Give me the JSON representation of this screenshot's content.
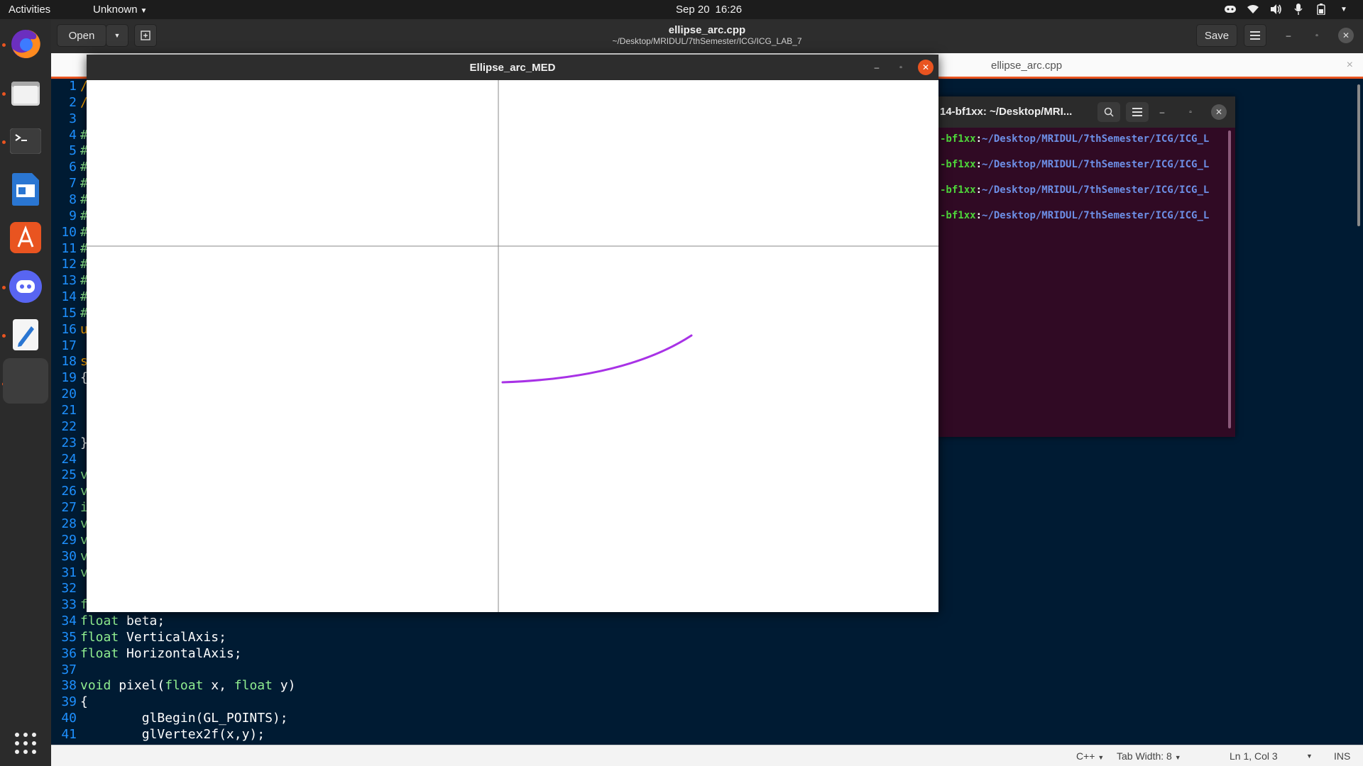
{
  "topbar": {
    "activities": "Activities",
    "app_menu": "Unknown",
    "date": "Sep 20",
    "time": "16:26",
    "tray_icons": [
      "discord-icon",
      "wifi-icon",
      "volume-icon",
      "microphone-icon",
      "battery-icon",
      "chevron-down-icon"
    ]
  },
  "dock": {
    "items": [
      "firefox-icon",
      "files-icon",
      "terminal-icon",
      "writer-icon",
      "app-center-icon",
      "discord-icon",
      "text-editor-icon",
      "active-window-icon"
    ],
    "show_apps_icon": "grid-icon"
  },
  "editor": {
    "open_label": "Open",
    "title": "ellipse_arc.cpp",
    "path": "~/Desktop/MRIDUL/7thSemester/ICG/ICG_LAB_7",
    "save_label": "Save",
    "tab_label": "ellipse_arc.cpp",
    "tab_close": "×",
    "lines": [
      {
        "n": "1",
        "parts": [
          [
            "kw2",
            "/"
          ]
        ]
      },
      {
        "n": "2",
        "parts": [
          [
            "kw2",
            "/"
          ]
        ]
      },
      {
        "n": "3",
        "parts": []
      },
      {
        "n": "4",
        "parts": [
          [
            "kw",
            "#"
          ]
        ]
      },
      {
        "n": "5",
        "parts": [
          [
            "kw",
            "#"
          ]
        ]
      },
      {
        "n": "6",
        "parts": [
          [
            "kw",
            "#"
          ]
        ]
      },
      {
        "n": "7",
        "parts": [
          [
            "kw",
            "#"
          ]
        ]
      },
      {
        "n": "8",
        "parts": [
          [
            "kw",
            "#"
          ]
        ]
      },
      {
        "n": "9",
        "parts": [
          [
            "kw",
            "#"
          ]
        ]
      },
      {
        "n": "10",
        "parts": [
          [
            "kw",
            "#"
          ]
        ]
      },
      {
        "n": "11",
        "parts": [
          [
            "kw",
            "#"
          ]
        ]
      },
      {
        "n": "12",
        "parts": [
          [
            "kw",
            "#"
          ]
        ]
      },
      {
        "n": "13",
        "parts": [
          [
            "kw",
            "#"
          ]
        ]
      },
      {
        "n": "14",
        "parts": [
          [
            "kw",
            "#"
          ]
        ]
      },
      {
        "n": "15",
        "parts": [
          [
            "kw",
            "#"
          ]
        ]
      },
      {
        "n": "16",
        "parts": [
          [
            "kw2",
            "u"
          ]
        ]
      },
      {
        "n": "17",
        "parts": []
      },
      {
        "n": "18",
        "parts": [
          [
            "kw2",
            "s"
          ]
        ]
      },
      {
        "n": "19",
        "parts": [
          [
            "txt",
            "{"
          ]
        ]
      },
      {
        "n": "20",
        "parts": []
      },
      {
        "n": "21",
        "parts": []
      },
      {
        "n": "22",
        "parts": []
      },
      {
        "n": "23",
        "parts": [
          [
            "txt",
            "}"
          ]
        ]
      },
      {
        "n": "24",
        "parts": []
      },
      {
        "n": "25",
        "parts": [
          [
            "kw",
            "v"
          ]
        ]
      },
      {
        "n": "26",
        "parts": [
          [
            "kw",
            "v"
          ]
        ]
      },
      {
        "n": "27",
        "parts": [
          [
            "kw",
            "i"
          ]
        ]
      },
      {
        "n": "28",
        "parts": [
          [
            "kw",
            "v"
          ]
        ]
      },
      {
        "n": "29",
        "parts": [
          [
            "kw",
            "v"
          ]
        ]
      },
      {
        "n": "30",
        "parts": [
          [
            "kw",
            "v"
          ]
        ]
      },
      {
        "n": "31",
        "parts": [
          [
            "kw",
            "v"
          ]
        ]
      },
      {
        "n": "32",
        "parts": []
      },
      {
        "n": "33",
        "parts": [
          [
            "kw",
            "f"
          ]
        ]
      },
      {
        "n": "34",
        "parts": [
          [
            "kw",
            "float"
          ],
          [
            "txt",
            " beta;"
          ]
        ]
      },
      {
        "n": "35",
        "parts": [
          [
            "kw",
            "float"
          ],
          [
            "txt",
            " VerticalAxis;"
          ]
        ]
      },
      {
        "n": "36",
        "parts": [
          [
            "kw",
            "float"
          ],
          [
            "txt",
            " HorizontalAxis;"
          ]
        ]
      },
      {
        "n": "37",
        "parts": []
      },
      {
        "n": "38",
        "parts": [
          [
            "kw",
            "void"
          ],
          [
            "txt",
            " pixel("
          ],
          [
            "kw",
            "float"
          ],
          [
            "txt",
            " x, "
          ],
          [
            "kw",
            "float"
          ],
          [
            "txt",
            " y)"
          ]
        ]
      },
      {
        "n": "39",
        "parts": [
          [
            "txt",
            "{"
          ]
        ]
      },
      {
        "n": "40",
        "parts": [
          [
            "txt",
            "        glBegin(GL_POINTS);"
          ]
        ]
      },
      {
        "n": "41",
        "parts": [
          [
            "txt",
            "        glVertex2f(x,y);"
          ]
        ]
      }
    ],
    "status": {
      "language": "C++",
      "tab_width": "Tab Width: 8",
      "position": "Ln 1, Col 3",
      "mode": "INS"
    }
  },
  "terminal": {
    "title": "14-bf1xx: ~/Desktop/MRI...",
    "lines": [
      {
        "user": "-bf1xx",
        "sep": ":",
        "path": "~/Desktop/MRIDUL/7thSemester/ICG/ICG_L"
      },
      {
        "user": "-bf1xx",
        "sep": ":",
        "path": "~/Desktop/MRIDUL/7thSemester/ICG/ICG_L"
      },
      {
        "user": "-bf1xx",
        "sep": ":",
        "path": "~/Desktop/MRIDUL/7thSemester/ICG/ICG_L"
      },
      {
        "user": "-bf1xx",
        "sep": ":",
        "path": "~/Desktop/MRIDUL/7thSemester/ICG/ICG_L"
      }
    ]
  },
  "glut": {
    "title": "Ellipse_arc_MED",
    "arc_color": "#a832e6",
    "axis_color": "#8a8a8a"
  }
}
